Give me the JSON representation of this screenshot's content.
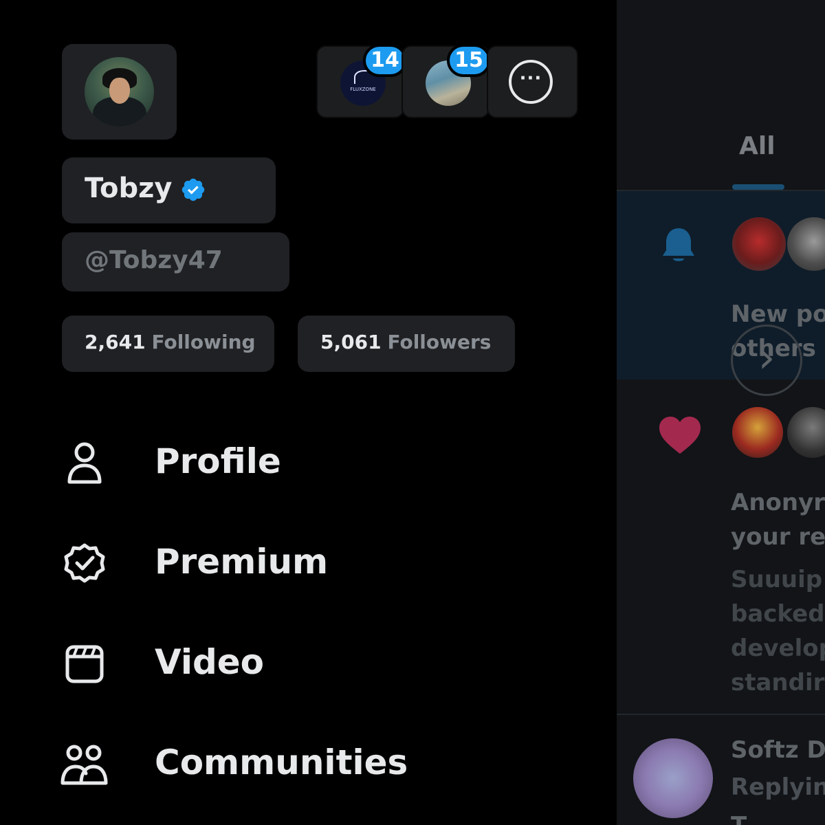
{
  "drawer": {
    "user": {
      "name": "Tobzy",
      "handle": "@Tobzy47",
      "following_count": "2,641",
      "following_label": "Following",
      "followers_count": "5,061",
      "followers_label": "Followers"
    },
    "accounts": [
      {
        "avatar_text": "FLUXZONE",
        "badge": "14"
      },
      {
        "badge": "15"
      }
    ],
    "more_accounts_label": "···",
    "menu": [
      {
        "label": "Profile",
        "icon": "person-icon"
      },
      {
        "label": "Premium",
        "icon": "verified-badge-icon"
      },
      {
        "label": "Video",
        "icon": "video-clapper-icon"
      },
      {
        "label": "Communities",
        "icon": "people-icon"
      }
    ]
  },
  "feed": {
    "tab_all": "All",
    "notifications": [
      {
        "icon": "bell-icon",
        "text": "New po",
        "text2": "others"
      },
      {
        "icon": "heart-icon",
        "title_line1": "Anonyr",
        "title_line2": "your re",
        "body": [
          "Suuuip",
          "backed",
          "develop",
          "standir"
        ]
      },
      {
        "name": "Softz D",
        "reply": "Replyin",
        "more": "T"
      }
    ],
    "next_label": "›"
  },
  "colors": {
    "background": "#000000",
    "chip": "#202124",
    "accent": "#1d9bf0",
    "text": "#e7e9ea",
    "muted": "#71767b",
    "heart": "#a3294f"
  }
}
